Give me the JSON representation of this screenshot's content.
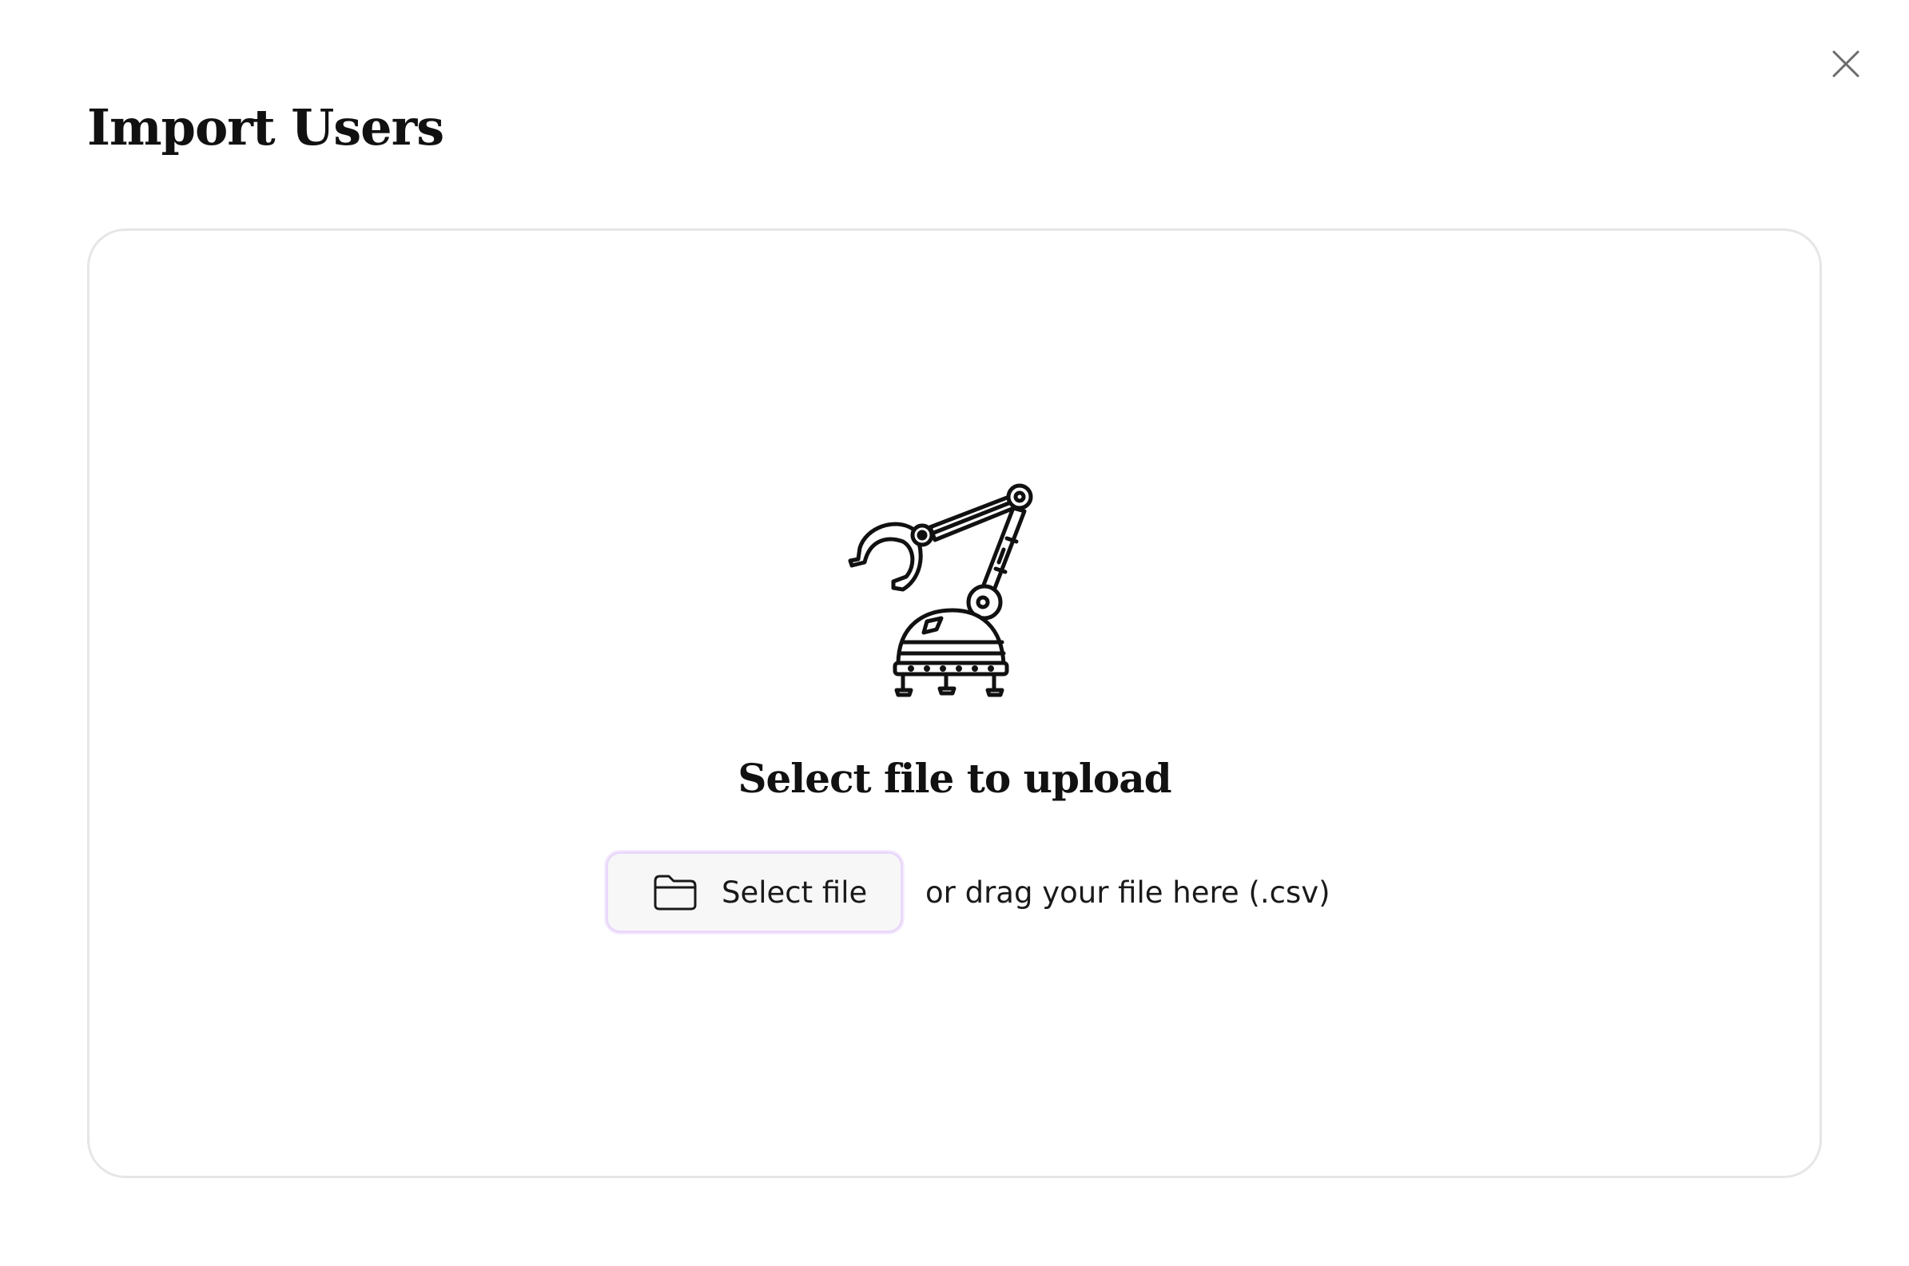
{
  "dialog": {
    "title": "Import Users",
    "close_icon": "close-icon"
  },
  "dropzone": {
    "illustration": "robot-arm-illustration",
    "heading": "Select file to upload",
    "select_button": {
      "icon": "folder-icon",
      "label": "Select file"
    },
    "drag_hint": "or drag your file here (.csv)"
  },
  "colors": {
    "background": "#ffffff",
    "dropzone_border": "#e6e6e6",
    "button_border_accent": "#ead9fb",
    "button_background": "#f7f7f8",
    "text": "#111111"
  }
}
